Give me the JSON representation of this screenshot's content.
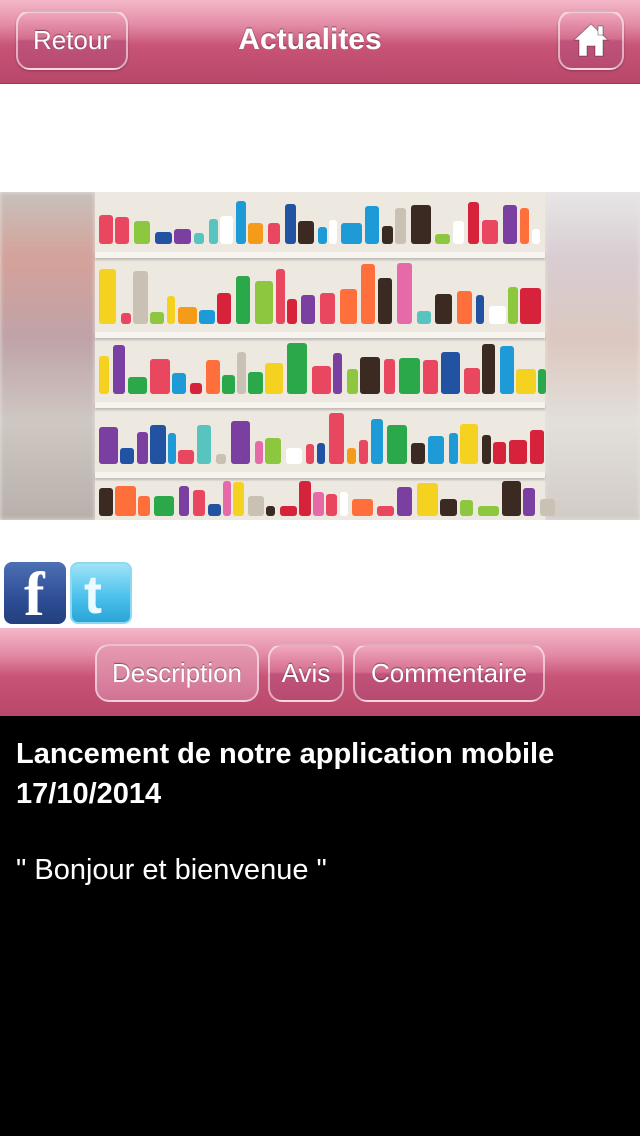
{
  "header": {
    "back_label": "Retour",
    "title": "Actualites",
    "home_icon": "home-icon"
  },
  "photo": {
    "description": "shop-shelves-with-ribbon-spools"
  },
  "social": {
    "facebook_icon": "facebook-icon",
    "facebook_glyph": "f",
    "twitter_icon": "twitter-icon",
    "twitter_glyph": "t"
  },
  "tabs": [
    {
      "label": "Description",
      "active": true
    },
    {
      "label": "Avis",
      "active": false
    },
    {
      "label": "Commentaire",
      "active": false
    }
  ],
  "article": {
    "title": "Lancement de notre application mobile",
    "date": "17/10/2014",
    "message": "\" Bonjour et bienvenue \""
  },
  "colors": {
    "accent": "#c85477",
    "content_bg": "#000000",
    "text": "#ffffff"
  }
}
